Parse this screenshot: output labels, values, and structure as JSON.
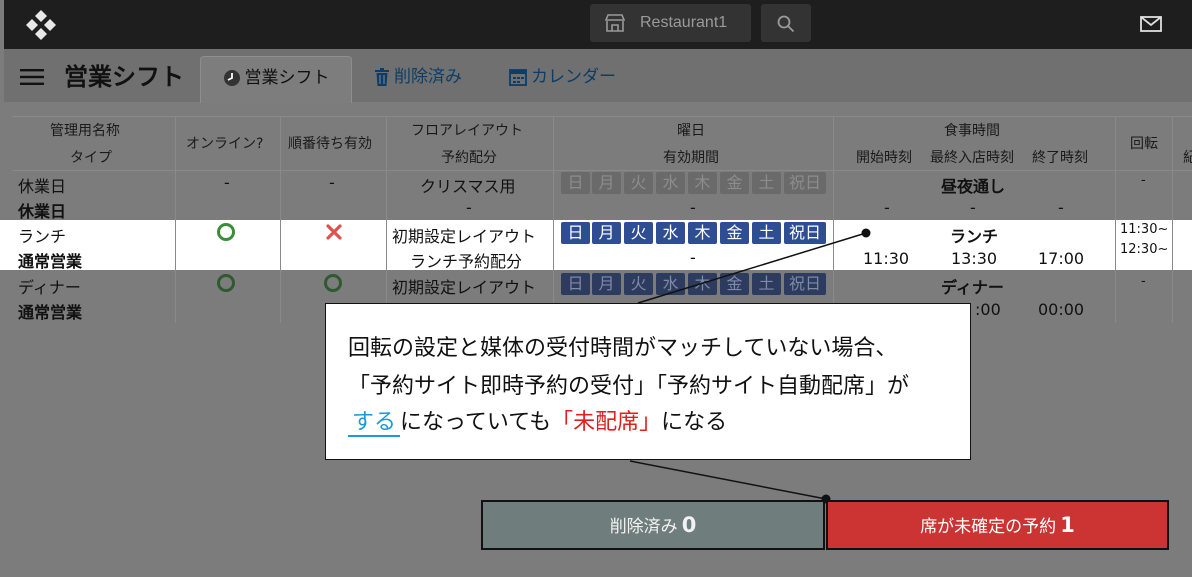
{
  "topbar": {
    "store_name": "Restaurant1",
    "logo_icon": "brand-logo-icon",
    "store_icon": "store-icon",
    "search_icon": "search-icon",
    "mail_icon": "mail-icon"
  },
  "page": {
    "title": "営業シフト"
  },
  "tabs": [
    {
      "label": "営業シフト",
      "icon": "clock-icon",
      "active": true
    },
    {
      "label": "削除済み",
      "icon": "trash-icon",
      "active": false
    },
    {
      "label": "カレンダー",
      "icon": "calendar-icon",
      "active": false
    }
  ],
  "table": {
    "headers": {
      "name": "管理用名称",
      "type": "タイプ",
      "online": "オンライン?",
      "queue": "順番待ち有効",
      "floor": "フロアレイアウト",
      "alloc": "予約配分",
      "weekday": "曜日",
      "period": "有効期間",
      "meal_time": "食事時間",
      "start": "開始時刻",
      "last_entry": "最終入店時刻",
      "end": "終了時刻",
      "rotation": "回転",
      "extra": "紀"
    },
    "day_labels": [
      "日",
      "月",
      "火",
      "水",
      "木",
      "金",
      "土",
      "祝日"
    ],
    "rows": [
      {
        "name": "休業日",
        "type": "休業日",
        "online": "-",
        "queue": "-",
        "floor": "クリスマス用",
        "alloc": "-",
        "period": "-",
        "meal": "昼夜通し",
        "start": "-",
        "last_entry": "-",
        "end": "-",
        "rotation": "-"
      },
      {
        "name": "ランチ",
        "type": "通常営業",
        "online": "circle-icon",
        "queue": "cross-icon",
        "floor": "初期設定レイアウト",
        "alloc": "ランチ予約配分",
        "period": "-",
        "meal": "ランチ",
        "start": "11:30",
        "last_entry": "13:30",
        "end": "17:00",
        "rotation": [
          "11:30~",
          "12:30~"
        ]
      },
      {
        "name": "ディナー",
        "type": "通常営業",
        "online": "circle-icon",
        "queue": "circle-icon",
        "floor": "初期設定レイアウト",
        "alloc": "",
        "period": "",
        "meal": "ディナー",
        "start": "",
        "last_entry": ":00",
        "end": "00:00",
        "rotation": "-"
      }
    ]
  },
  "callout": {
    "line1": "回転の設定と媒体の受付時間がマッチしていない場合、",
    "line2": "「予約サイト即時予約の受付」「予約サイト自動配席」が",
    "line3_highlight": "する",
    "line3_mid": "になっていても",
    "line3_red": "「未配席」",
    "line3_end": "になる",
    "highlight_color": "#1a9bd7",
    "red_color": "#e02020"
  },
  "buttons": {
    "deleted_label": "削除済み",
    "deleted_count": "0",
    "unassigned_label": "席が未確定の予約",
    "unassigned_count": "1"
  }
}
